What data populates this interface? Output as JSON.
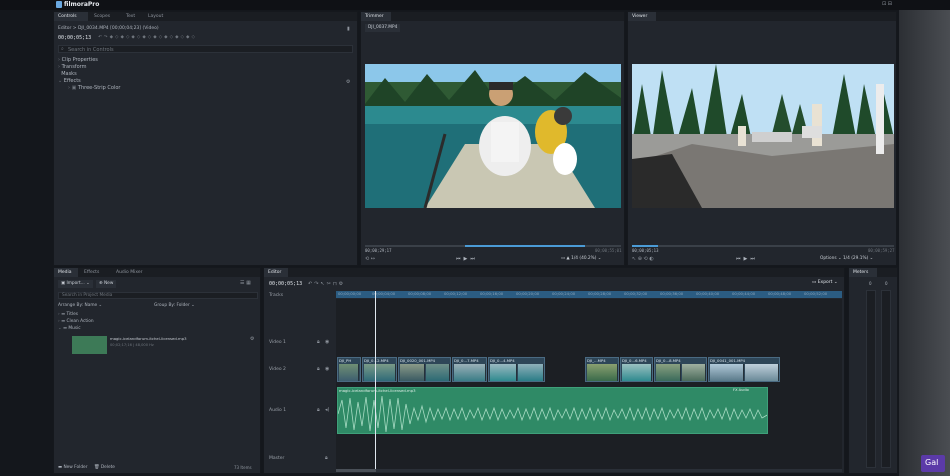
{
  "app": {
    "name": "filmoraPro"
  },
  "top_tabs": [
    "Controls",
    "Scopes",
    "Text",
    "Layout"
  ],
  "controls": {
    "breadcrumb": "Editor > DJI_0034.MP4 [00;00;04;23] (Video)",
    "timecode": "00;00;05;13",
    "search_placeholder": "Search in Controls",
    "tree": [
      "Clip Properties",
      "Transform",
      "Masks",
      "Effects",
      "Three-Strip Color"
    ]
  },
  "trimmer": {
    "tab": "Trimmer",
    "clip_tab": "DJI_0037.MP4",
    "tc_left": "00;00;29;17",
    "tc_right": "00;00;55;01",
    "zoom": "1/4",
    "zoom_pct": "(40.2%)"
  },
  "viewer": {
    "tab": "Viewer",
    "tc_left": "00;00;05;13",
    "tc_right": "00;00;59;27",
    "options_label": "Options",
    "zoom": "1/4",
    "zoom_pct": "(29.1%)"
  },
  "media": {
    "tabs": [
      "Media",
      "Effects",
      "Audio Mixer"
    ],
    "import_label": "Import...",
    "new_label": "New",
    "search_placeholder": "Search in Project Media",
    "arrange_label": "Arrange By: Name",
    "group_label": "Group By: Folder",
    "folders": [
      "Titles",
      "Clean Action",
      "Music"
    ],
    "item_name": "magic-icelandforum-itchel-licensed.mp3",
    "item_meta": "00;02;17;16 | 48,000 Hz",
    "new_folder_label": "New Folder",
    "delete_label": "Delete",
    "count_label": "73 Items"
  },
  "editor": {
    "tab": "Editor",
    "timecode": "00;00;05;13",
    "export_label": "Export",
    "tracks_label": "Tracks",
    "tracks": [
      "Video 1",
      "Video 2",
      "Audio 1",
      "Master"
    ],
    "ruler": [
      "00;00;00;00",
      "00;00;04;00",
      "00;00;08;00",
      "00;00;12;00",
      "00;00;16;00",
      "00;00;20;00",
      "00;00;24;00",
      "00;00;28;00",
      "00;00;32;00",
      "00;00;36;00",
      "00;00;40;00",
      "00;00;44;00",
      "00;00;48;00",
      "00;00;52;00"
    ],
    "video2_clips": [
      "DJI_PH",
      "DJI_0...2.MP4",
      "DJI_0020_001.MP4",
      "DJI_0...7.MP4",
      "DJI_0...4.MP4",
      "DJI_...MP4",
      "DJI_0...6.MP4",
      "DJI_0...8.MP4",
      "DJI_0041_001.MP4"
    ],
    "audio_clip": "magic-icelandforum-itchel-licensed.mp3",
    "audio_fx": "FX Audio"
  },
  "meters": {
    "tab": "Meters",
    "left": "0",
    "right": "0"
  },
  "watermark": "Gal",
  "colors": {
    "accent": "#4b9bd6",
    "video_clip": "#2e4658",
    "audio_clip": "#2f8a66",
    "playhead": "#dfe7ef"
  }
}
